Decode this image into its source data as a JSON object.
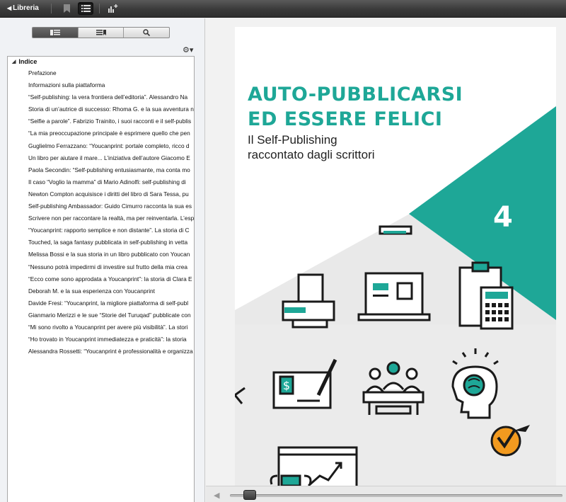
{
  "toolbar": {
    "back_label": "Libreria",
    "icons": [
      "bookmark-icon",
      "list-view-icon",
      "chart-add-icon"
    ]
  },
  "sidebar": {
    "tabs": [
      "toc-tab-icon",
      "bookmarks-tab-icon",
      "search-tab-icon"
    ],
    "toc_header": "Indice",
    "items": [
      "Prefazione",
      "Informazioni sulla piattaforma",
      "“Self-publishing: la vera frontiera dell’editoria”. Alessandro Na",
      "Storia di un’autrice di successo: Rhoma G. e la sua avventura n",
      "“Selfie a parole”. Fabrizio Trainito, i suoi racconti e il self-publis",
      "“La mia preoccupazione principale è esprimere quello che pen",
      "Guglielmo Ferrazzano: “Youcanprint: portale completo, ricco d",
      "Un libro per aiutare il mare... L’iniziativa dell’autore Giacomo E",
      "Paola Secondin: “Self-publishing entusiasmante, ma conta mo",
      "Il caso “Voglio la mamma” di Mario Adinolfi: self-publishing di",
      "Newton Compton acquisisce i diritti del libro di Sara Tessa, pu",
      "Self-publishing Ambassador: Guido Cimurro racconta la sua es",
      "Scrivere non per raccontare la realtà, ma per reinventarla. L’esp",
      "“Youcanprint: rapporto semplice e non distante”. La storia di C",
      "Touched, la saga fantasy pubblicata in self-publishing in vetta",
      "Melissa Bossi e la sua storia in un libro pubblicato con Youcan",
      "“Nessuno potrà impedirmi di investire sul frutto della mia crea",
      "“Ecco come sono approdata a Youcanprint”: la storia di Clara E",
      "Deborah M. e la sua esperienza con Youcanprint",
      "Davide Fresi: “Youcanprint, la migliore piattaforma di self-publ",
      "Gianmario Merizzi e le sue “Storie del Turuqad” pubblicate con",
      "“Mi sono rivolto a Youcanprint per avere più visibilità”. La stori",
      "“Ho trovato in Youcanprint immediatezza e praticità”: la storia",
      "Alessandra Rossetti: “Youcanprint è professionalità e organizza"
    ]
  },
  "cover": {
    "title_line1": "AUTO-PUBBLICARSI",
    "title_line2": "ED ESSERE FELICI",
    "subtitle_line1": "Il Self-Publishing",
    "subtitle_line2": "raccontato dagli scrittori",
    "volume_number": "4",
    "accent_color": "#1ea797",
    "logo_color": "#f29a1f"
  },
  "scrubber": {
    "progress_fraction": 0.04
  }
}
